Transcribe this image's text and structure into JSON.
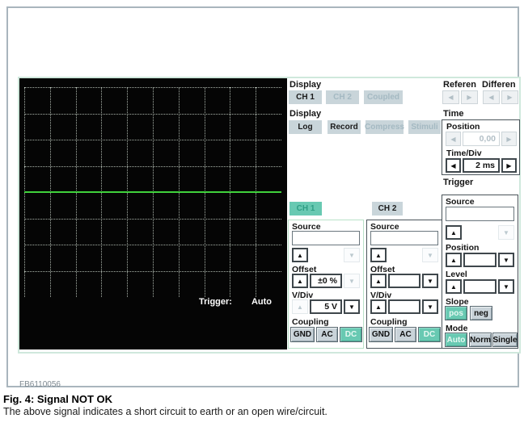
{
  "scope": {
    "grid": {
      "cols": 10,
      "rows": 8
    },
    "trace": {
      "shape": "flat-horizontal-line",
      "position_fraction": 0.5,
      "color": "#40d23c"
    },
    "trigger_label": "Trigger:",
    "trigger_value": "Auto"
  },
  "icons": {
    "up": "▲",
    "down": "▼",
    "left": "◀",
    "right": "▶"
  },
  "display_channels": {
    "label": "Display",
    "ch1": "CH 1",
    "ch2": "CH 2",
    "coupled": "Coupled"
  },
  "display_modes": {
    "label": "Display",
    "log": "Log",
    "record": "Record",
    "compress": "Compress",
    "stimuli": "Stimuli"
  },
  "reference": {
    "label": "Referen"
  },
  "differential": {
    "label": "Differen"
  },
  "time": {
    "label": "Time",
    "position_label": "Position",
    "position_value": "0,00",
    "timediv_label": "Time/Div",
    "timediv_value": "2 ms"
  },
  "trigger": {
    "label": "Trigger",
    "source_label": "Source",
    "source_value": "",
    "position_label": "Position",
    "position_value": "",
    "level_label": "Level",
    "level_value": "",
    "slope_label": "Slope",
    "slope_pos": "pos",
    "slope_neg": "neg",
    "mode_label": "Mode",
    "mode_auto": "Auto",
    "mode_norm": "Norm",
    "mode_single": "Single"
  },
  "ch1": {
    "tab": "CH 1",
    "source_label": "Source",
    "source_value": "",
    "offset_label": "Offset",
    "offset_value": "±0 %",
    "vdiv_label": "V/Div",
    "vdiv_value": "5 V",
    "coupling_label": "Coupling",
    "gnd": "GND",
    "ac": "AC",
    "dc": "DC"
  },
  "ch2": {
    "tab": "CH 2",
    "source_label": "Source",
    "source_value": "",
    "offset_label": "Offset",
    "offset_value": "",
    "vdiv_label": "V/Div",
    "vdiv_value": "",
    "coupling_label": "Coupling",
    "gnd": "GND",
    "ac": "AC",
    "dc": "DC"
  },
  "footer": {
    "code": "FB6110056",
    "figure_title": "Fig. 4: Signal NOT OK",
    "figure_caption": "The above signal indicates a short circuit to earth or an open wire/circuit."
  },
  "colors": {
    "teal": "#68c9b2",
    "trace_green": "#40d23c",
    "panel_button_gray": "#c9d5da"
  }
}
